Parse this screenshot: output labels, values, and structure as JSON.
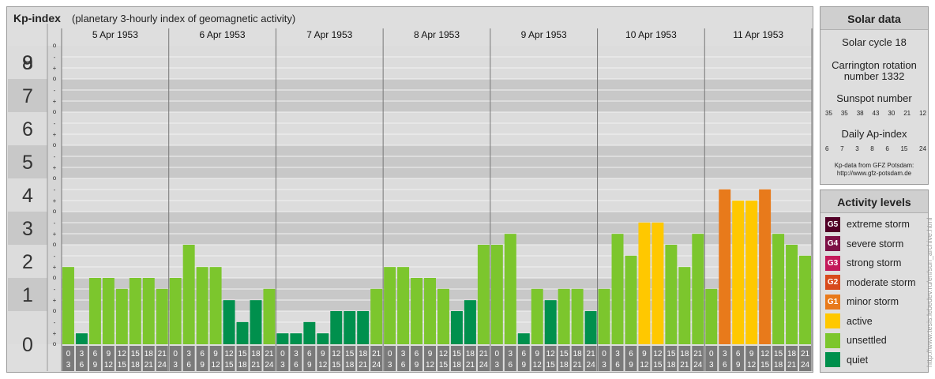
{
  "header": {
    "title": "Kp-index",
    "subtitle": "(planetary 3-hourly index of geomagnetic activity)"
  },
  "colors": {
    "quiet": "#00904d",
    "unsettled": "#7cc62d",
    "active": "#ffc800",
    "G1": "#e87a1b",
    "G2": "#d84a1c",
    "G3": "#c41a5a",
    "G4": "#7d1045",
    "G5": "#520027"
  },
  "chart_data": {
    "type": "bar",
    "ylim": [
      0,
      9
    ],
    "y_ticks": [
      "0",
      "1",
      "2",
      "3",
      "4",
      "5",
      "6",
      "7",
      "8",
      "9"
    ],
    "y_minor_marks": [
      "+",
      "o",
      "-"
    ],
    "day_labels": [
      "5 Apr 1953",
      "6 Apr 1953",
      "7 Apr 1953",
      "8 Apr 1953",
      "9 Apr 1953",
      "10 Apr 1953",
      "11 Apr 1953"
    ],
    "interval_labels": [
      [
        "0",
        "3"
      ],
      [
        "3",
        "6"
      ],
      [
        "6",
        "9"
      ],
      [
        "9",
        "12"
      ],
      [
        "12",
        "15"
      ],
      [
        "15",
        "18"
      ],
      [
        "18",
        "21"
      ],
      [
        "21",
        "24"
      ]
    ],
    "values": [
      2.33,
      0.33,
      2.0,
      2.0,
      1.67,
      2.0,
      2.0,
      1.67,
      2.0,
      3.0,
      2.33,
      2.33,
      1.33,
      0.67,
      1.33,
      1.67,
      0.33,
      0.33,
      0.67,
      0.33,
      1.0,
      1.0,
      1.0,
      1.67,
      2.33,
      2.33,
      2.0,
      2.0,
      1.67,
      1.0,
      1.33,
      3.0,
      3.0,
      3.33,
      0.33,
      1.67,
      1.33,
      1.67,
      1.67,
      1.0,
      1.67,
      3.33,
      2.67,
      3.67,
      3.67,
      3.0,
      2.33,
      3.33,
      1.67,
      4.67,
      4.33,
      4.33,
      4.67,
      3.33,
      3.0,
      2.67
    ],
    "levels": [
      "unsettled",
      "quiet",
      "unsettled",
      "unsettled",
      "unsettled",
      "unsettled",
      "unsettled",
      "unsettled",
      "unsettled",
      "unsettled",
      "unsettled",
      "unsettled",
      "quiet",
      "quiet",
      "quiet",
      "unsettled",
      "quiet",
      "quiet",
      "quiet",
      "quiet",
      "quiet",
      "quiet",
      "quiet",
      "unsettled",
      "unsettled",
      "unsettled",
      "unsettled",
      "unsettled",
      "unsettled",
      "quiet",
      "quiet",
      "unsettled",
      "unsettled",
      "unsettled",
      "quiet",
      "unsettled",
      "quiet",
      "unsettled",
      "unsettled",
      "quiet",
      "unsettled",
      "unsettled",
      "unsettled",
      "active",
      "active",
      "unsettled",
      "unsettled",
      "unsettled",
      "unsettled",
      "G1",
      "active",
      "active",
      "G1",
      "unsettled",
      "unsettled",
      "unsettled"
    ]
  },
  "solar": {
    "title": "Solar data",
    "cycle": "Solar cycle 18",
    "carrington_line1": "Carrington rotation",
    "carrington_line2": "number 1332",
    "sunspot_label": "Sunspot number",
    "sunspot_values": [
      "35",
      "35",
      "38",
      "43",
      "30",
      "21",
      "12"
    ],
    "ap_label": "Daily Ap-index",
    "ap_values": [
      "6",
      "7",
      "3",
      "8",
      "6",
      "15",
      "24"
    ],
    "credit_line1": "Kp-data from GFZ Potsdam:",
    "credit_line2": "http://www.gfz-potsdam.de"
  },
  "activity": {
    "title": "Activity levels",
    "items": [
      {
        "code": "G5",
        "label": "extreme storm",
        "color": "#520027"
      },
      {
        "code": "G4",
        "label": "severe storm",
        "color": "#7d1045"
      },
      {
        "code": "G3",
        "label": "strong storm",
        "color": "#c41a5a"
      },
      {
        "code": "G2",
        "label": "moderate storm",
        "color": "#d84a1c"
      },
      {
        "code": "G1",
        "label": "minor storm",
        "color": "#e87a1b"
      },
      {
        "code": "",
        "label": "active",
        "color": "#ffc800"
      },
      {
        "code": "",
        "label": "unsettled",
        "color": "#7cc62d"
      },
      {
        "code": "",
        "label": "quiet",
        "color": "#00904d"
      }
    ]
  },
  "watermark": "http://www.tesis.lebedev.ru/en/sun_archive.html"
}
